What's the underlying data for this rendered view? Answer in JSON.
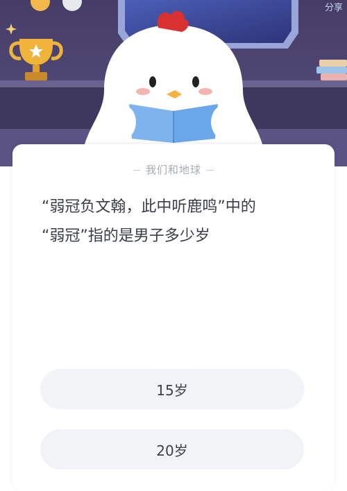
{
  "header": {
    "share_label": "分享"
  },
  "quiz": {
    "category": "我们和地球",
    "question_line1": "“弱冠负文翰，此中听鹿鸣”中的",
    "question_line2": "“弱冠”指的是男子多少岁",
    "options": [
      {
        "label": "15岁"
      },
      {
        "label": "20岁"
      }
    ]
  },
  "colors": {
    "background_dark": "#4d4470",
    "shelf": "#3a3358",
    "accent_red": "#d8312f",
    "trophy_gold": "#f0b43a",
    "book_blue": "#6aa6ea"
  }
}
